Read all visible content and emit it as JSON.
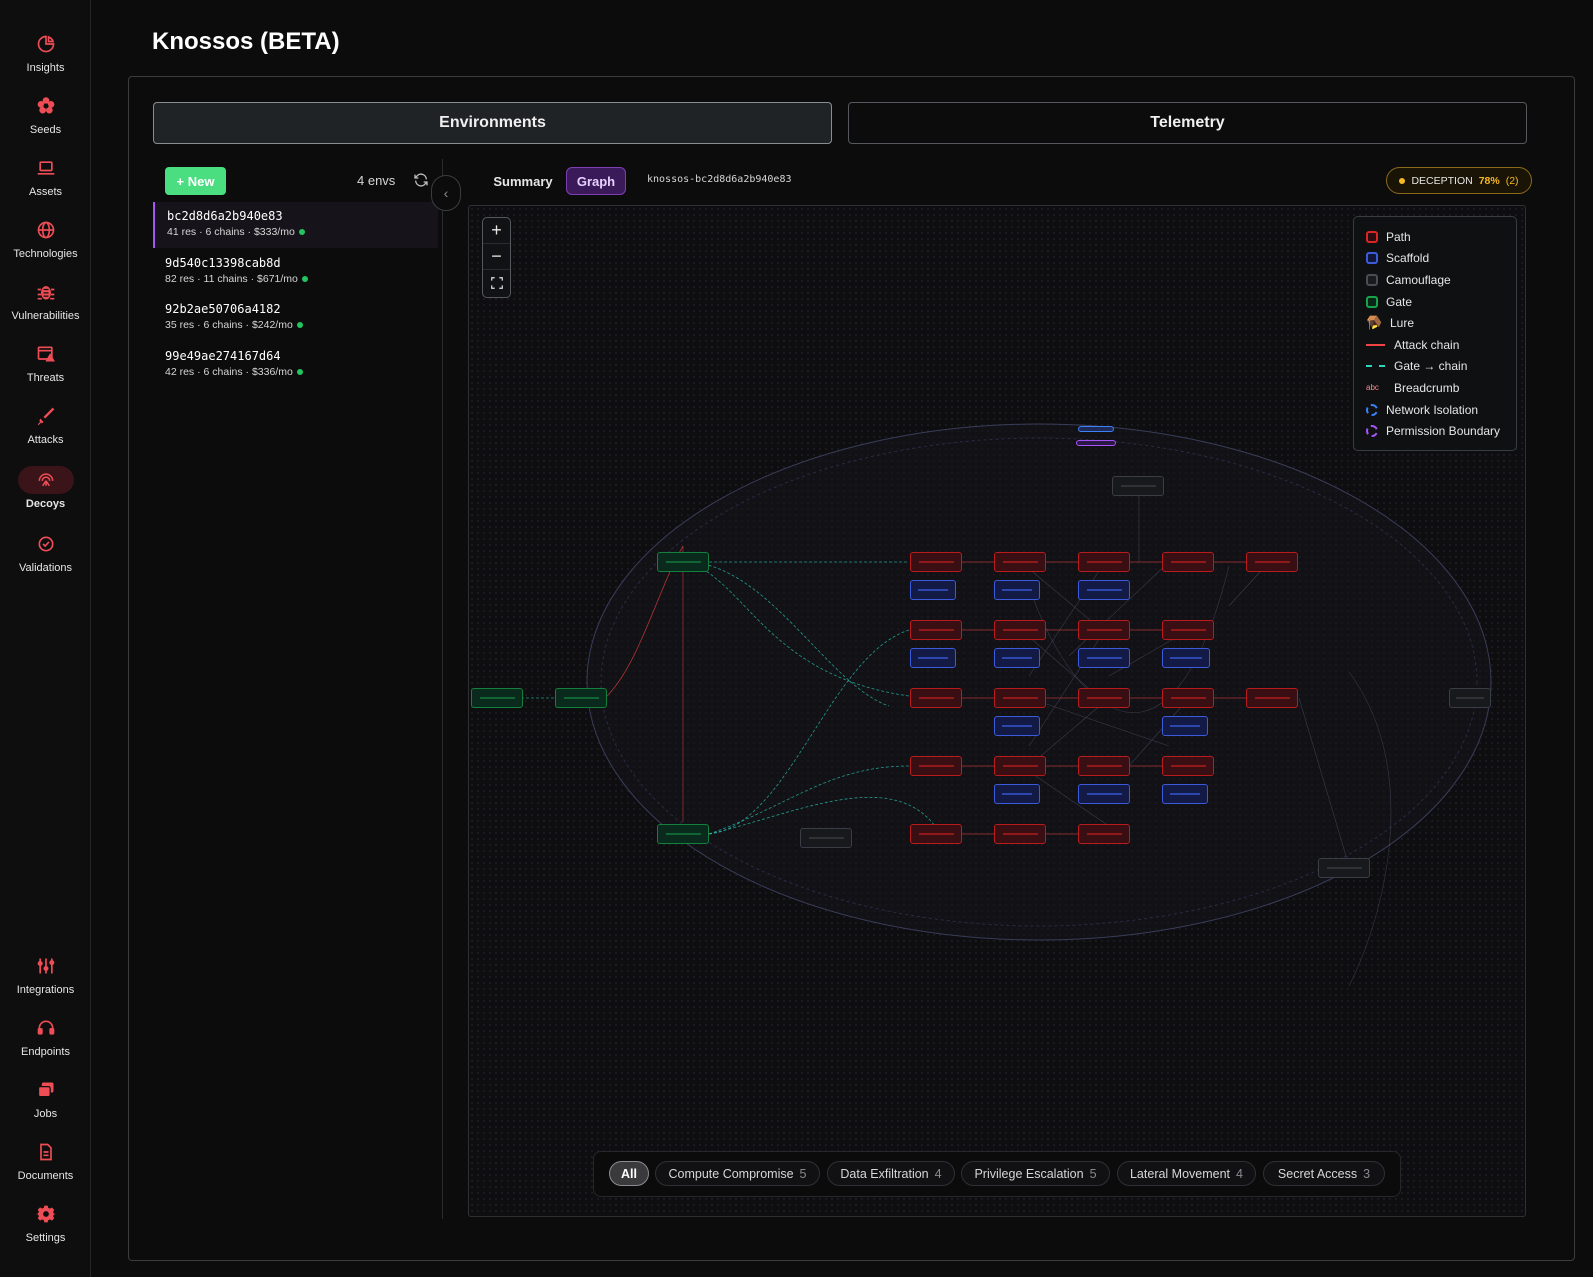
{
  "app": {
    "title": "Knossos (BETA)"
  },
  "colors": {
    "accent_red": "#ef4444",
    "accent_green": "#4ade80",
    "accent_purple": "#a855f7",
    "deception_gold": "#f5b921"
  },
  "sidebar": {
    "top_items": [
      {
        "label": "Insights",
        "icon": "pie-chart-icon"
      },
      {
        "label": "Seeds",
        "icon": "flower-icon"
      },
      {
        "label": "Assets",
        "icon": "laptop-icon"
      },
      {
        "label": "Technologies",
        "icon": "globe-icon"
      },
      {
        "label": "Vulnerabilities",
        "icon": "bug-icon"
      },
      {
        "label": "Threats",
        "icon": "alert-window-icon"
      },
      {
        "label": "Attacks",
        "icon": "sword-icon"
      },
      {
        "label": "Decoys",
        "icon": "radar-icon",
        "active": true
      },
      {
        "label": "Validations",
        "icon": "check-circle-icon"
      }
    ],
    "bottom_items": [
      {
        "label": "Integrations",
        "icon": "sliders-icon"
      },
      {
        "label": "Endpoints",
        "icon": "headset-icon"
      },
      {
        "label": "Jobs",
        "icon": "stack-icon"
      },
      {
        "label": "Documents",
        "icon": "document-icon"
      },
      {
        "label": "Settings",
        "icon": "gear-icon"
      }
    ]
  },
  "tabs": {
    "environments": "Environments",
    "telemetry": "Telemetry"
  },
  "env_list": {
    "new_label": "+ New",
    "count_label": "4 envs",
    "items": [
      {
        "id": "bc2d8d6a2b940e83",
        "meta": "41 res · 6 chains · $333/mo",
        "active": true
      },
      {
        "id": "9d540c13398cab8d",
        "meta": "82 res · 11 chains · $671/mo"
      },
      {
        "id": "92b2ae50706a4182",
        "meta": "35 res · 6 chains · $242/mo"
      },
      {
        "id": "99e49ae274167d64",
        "meta": "42 res · 6 chains · $336/mo"
      }
    ]
  },
  "graph_header": {
    "summary_label": "Summary",
    "graph_label": "Graph",
    "env_name": "knossos-bc2d8d6a2b940e83",
    "deception_label": "DECEPTION",
    "deception_pct": "78%",
    "deception_count": "(2)"
  },
  "legend": {
    "path": "Path",
    "scaffold": "Scaffold",
    "camouflage": "Camouflage",
    "gate": "Gate",
    "lure": "Lure",
    "attack_chain": "Attack chain",
    "gate_chain": "Gate → chain",
    "breadcrumb_glyph": "abc",
    "breadcrumb": "Breadcrumb",
    "network_isolation": "Network Isolation",
    "permission_boundary": "Permission Boundary"
  },
  "filters": [
    {
      "label": "All",
      "count": "",
      "active": true
    },
    {
      "label": "Compute Compromise",
      "count": "5"
    },
    {
      "label": "Data Exfiltration",
      "count": "4"
    },
    {
      "label": "Privilege Escalation",
      "count": "5"
    },
    {
      "label": "Lateral Movement",
      "count": "4"
    },
    {
      "label": "Secret Access",
      "count": "3"
    }
  ]
}
